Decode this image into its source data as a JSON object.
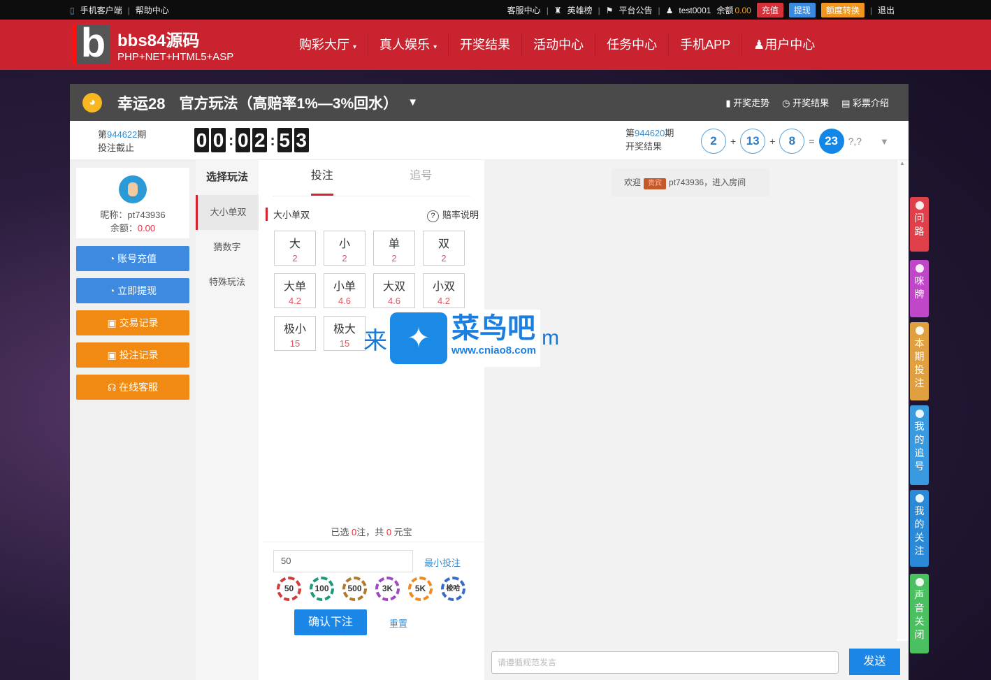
{
  "topbar": {
    "mobile": "手机客户端",
    "help": "帮助中心",
    "service": "客服中心",
    "heroes": "英雄榜",
    "notice": "平台公告",
    "user": "test0001",
    "balance_label": "余额",
    "balance": "0.00",
    "recharge": "充值",
    "withdraw": "提现",
    "convert": "额度转换",
    "logout": "退出"
  },
  "header": {
    "logo_text": "bbs84源码",
    "logo_sub": "PHP+NET+HTML5+ASP",
    "nav": [
      "购彩大厅",
      "真人娱乐",
      "开奖结果",
      "活动中心",
      "任务中心",
      "手机APP",
      "用户中心"
    ]
  },
  "game": {
    "name": "幸运28",
    "mode": "官方玩法（高赔率1%—3%回水）",
    "links": [
      "开奖走势",
      "开奖结果",
      "彩票介绍"
    ]
  },
  "current": {
    "prefix": "第",
    "issue": "944622",
    "suffix": "期",
    "label": "投注截止",
    "timer": [
      "0",
      "0",
      "0",
      "2",
      "5",
      "3"
    ]
  },
  "last": {
    "prefix": "第",
    "issue": "944620",
    "suffix": "期",
    "label": "开奖结果",
    "balls": [
      "2",
      "13",
      "8"
    ],
    "sum": "23",
    "plus": "+",
    "eq": "=",
    "extra": "?,?"
  },
  "user": {
    "nickname_label": "昵称：",
    "nickname": "pt743936",
    "balance_label": "余额：",
    "balance": "0.00"
  },
  "left_buttons": [
    {
      "label": "账号充值",
      "color": "#3d8ae0"
    },
    {
      "label": "立即提现",
      "color": "#3d8ae0"
    },
    {
      "label": "交易记录",
      "color": "#f08a12"
    },
    {
      "label": "投注记录",
      "color": "#f08a12"
    },
    {
      "label": "在线客服",
      "color": "#f08a12"
    }
  ],
  "play_menu": {
    "title": "选择玩法",
    "items": [
      "大小单双",
      "猜数字",
      "特殊玩法"
    ]
  },
  "bet": {
    "tabs": [
      "投注",
      "追号"
    ],
    "section": "大小单双",
    "odds_help": "赔率说明",
    "cells": [
      {
        "n": "大",
        "o": "2"
      },
      {
        "n": "小",
        "o": "2"
      },
      {
        "n": "单",
        "o": "2"
      },
      {
        "n": "双",
        "o": "2"
      },
      {
        "n": "大单",
        "o": "4.2"
      },
      {
        "n": "小单",
        "o": "4.6"
      },
      {
        "n": "大双",
        "o": "4.6"
      },
      {
        "n": "小双",
        "o": "4.2"
      },
      {
        "n": "极小",
        "o": "15"
      },
      {
        "n": "极大",
        "o": "15"
      }
    ],
    "summary": {
      "a": "已选 ",
      "count": "0",
      "b": "注，共 ",
      "total": "0",
      "c": " 元宝"
    },
    "amount": "50",
    "min_bet": "最小投注",
    "chips": [
      {
        "label": "50",
        "color": "#d23a3a"
      },
      {
        "label": "100",
        "color": "#1e9a7a"
      },
      {
        "label": "500",
        "color": "#b07a2a"
      },
      {
        "label": "3K",
        "color": "#a04ac0"
      },
      {
        "label": "5K",
        "color": "#f08a20"
      },
      {
        "label": "梭哈",
        "color": "#3a6ac8"
      }
    ],
    "confirm": "确认下注",
    "reset": "重置",
    "collapse": "«"
  },
  "chat": {
    "welcome": "欢迎",
    "vip": "贵宾",
    "user": "pt743936，进入房间",
    "placeholder": "请遵循规范发言",
    "send": "发送"
  },
  "side_tabs": [
    {
      "label": "问路",
      "color": "#e0404a"
    },
    {
      "label": "咪牌",
      "color": "#c048c8"
    },
    {
      "label": "本期投注",
      "color": "#e0a040"
    },
    {
      "label": "我的追号",
      "color": "#3a9ae0"
    },
    {
      "label": "我的关注",
      "color": "#2a8ad8"
    },
    {
      "label": "声音关闭",
      "color": "#4ac060"
    }
  ],
  "watermark": {
    "left": "来",
    "name": "菜鸟吧",
    "url": "www.cniao8.com",
    "right": "m"
  }
}
